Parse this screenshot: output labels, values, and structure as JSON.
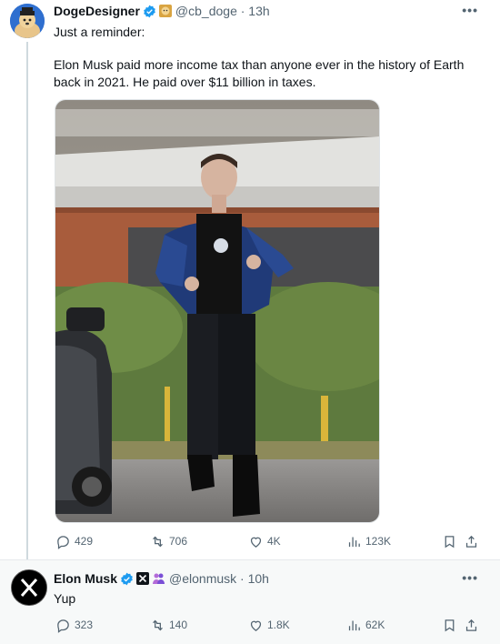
{
  "tweet1": {
    "author_name": "DogeDesigner",
    "handle_time": "@cb_doge · 13h",
    "line1": "Just a reminder:",
    "paragraph": "Elon Musk paid more income tax than anyone ever in the history of Earth back in 2021. He paid over $11 billion in taxes.",
    "stats": {
      "replies": "429",
      "reposts": "706",
      "likes": "4K",
      "views": "123K"
    }
  },
  "tweet2": {
    "author_name": "Elon Musk",
    "handle_time": "@elonmusk · 10h",
    "text": "Yup",
    "stats": {
      "replies": "323",
      "reposts": "140",
      "likes": "1.8K",
      "views": "62K"
    }
  },
  "icons": [
    "verified-badge-icon",
    "doge-badge-icon",
    "x-logo-badge-icon",
    "affiliate-badge-icon",
    "more-icon",
    "reply-icon",
    "repost-icon",
    "like-icon",
    "views-icon",
    "bookmark-icon",
    "share-icon"
  ],
  "colors": {
    "verified_blue": "#1d9bf0",
    "muted_text": "#536471",
    "thread_line": "#cfd9de",
    "affiliate_purple": "#b36bd8"
  }
}
